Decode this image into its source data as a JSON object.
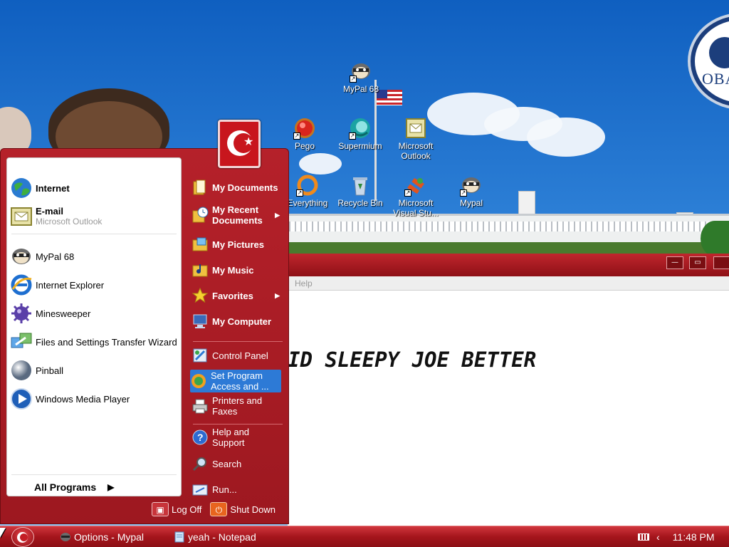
{
  "desktop": {
    "logo_text": "OBA",
    "icons": [
      {
        "label": "MyPal 68",
        "icon": "raccoon-icon"
      },
      {
        "label": "Pego",
        "icon": "pego-icon"
      },
      {
        "label": "Supermium",
        "icon": "supermium-icon"
      },
      {
        "label": "Microsoft Outlook",
        "icon": "outlook-icon"
      },
      {
        "label": "Everything",
        "icon": "everything-icon"
      },
      {
        "label": "Recycle Bin",
        "icon": "recycle-bin-icon"
      },
      {
        "label": "Microsoft Visual Stu...",
        "icon": "visual-studio-icon"
      },
      {
        "label": "Mypal",
        "icon": "raccoon-icon"
      }
    ]
  },
  "notepad": {
    "menu_visible": "Help",
    "content_text": "ID SLEEPY JOE BETTER",
    "buttons": {
      "minimize": "—",
      "maximize": "▭"
    }
  },
  "start_menu": {
    "pinned": [
      {
        "title": "Internet",
        "icon": "globe-icon"
      },
      {
        "title": "E-mail",
        "subtitle": "Microsoft Outlook",
        "icon": "outlook-icon"
      }
    ],
    "recent": [
      {
        "label": "MyPal 68",
        "icon": "raccoon-icon"
      },
      {
        "label": "Internet Explorer",
        "icon": "ie-icon"
      },
      {
        "label": "Minesweeper",
        "icon": "mine-icon"
      },
      {
        "label": "Files and Settings Transfer Wizard",
        "icon": "transfer-wizard-icon"
      },
      {
        "label": "Pinball",
        "icon": "pinball-icon"
      },
      {
        "label": "Windows Media Player",
        "icon": "media-player-icon"
      }
    ],
    "all_programs": "All Programs",
    "right": {
      "my_documents": "My Documents",
      "my_recent_documents": "My Recent Documents",
      "my_pictures": "My Pictures",
      "my_music": "My Music",
      "favorites": "Favorites",
      "my_computer": "My Computer",
      "control_panel": "Control Panel",
      "set_program_access": "Set Program Access and ...",
      "printers_and_faxes": "Printers and Faxes",
      "help_and_support": "Help and Support",
      "search": "Search",
      "run": "Run..."
    },
    "log_off": "Log Off",
    "shut_down": "Shut Down"
  },
  "taskbar": {
    "tasks": [
      "Options - Mypal",
      "yeah - Notepad"
    ],
    "clock": "11:48 PM"
  },
  "colors": {
    "accent_red": "#b5212a",
    "highlight_blue": "#2d7ad6",
    "sky_blue": "#2f82d8"
  }
}
